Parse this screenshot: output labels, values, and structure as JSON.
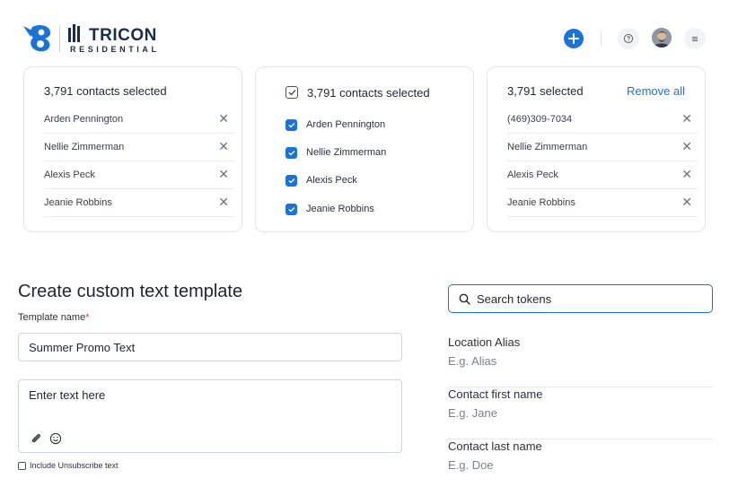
{
  "brand": {
    "name": "TRICON",
    "sub": "RESIDENTIAL",
    "accent": "#1a73d9",
    "navy": "#1c2b49"
  },
  "header": {
    "add_icon": "plus-icon",
    "help_icon": "question-icon",
    "menu_icon": "hamburger-icon"
  },
  "card1": {
    "title": "3,791 contacts selected",
    "items": [
      {
        "name": "Arden Pennington"
      },
      {
        "name": "Nellie Zimmerman"
      },
      {
        "name": "Alexis Peck"
      },
      {
        "name": "Jeanie Robbins"
      }
    ]
  },
  "card2": {
    "title": "3,791 contacts selected",
    "items": [
      {
        "name": "Arden Pennington",
        "checked": true
      },
      {
        "name": "Nellie Zimmerman",
        "checked": true
      },
      {
        "name": "Alexis Peck",
        "checked": true
      },
      {
        "name": "Jeanie Robbins",
        "checked": true
      }
    ]
  },
  "card3": {
    "title": "3,791 selected",
    "remove_all": "Remove all",
    "items": [
      {
        "name": "(469)309-7034"
      },
      {
        "name": "Nellie Zimmerman"
      },
      {
        "name": "Alexis Peck"
      },
      {
        "name": "Jeanie Robbins"
      }
    ]
  },
  "form": {
    "title": "Create custom text template",
    "name_label": "Template name",
    "required_mark": "*",
    "name_value": "Summer Promo Text",
    "message_placeholder": "Enter text here",
    "unsubscribe_label": "Include Unsubscribe text"
  },
  "tokens": {
    "search_placeholder": "Search tokens",
    "items": [
      {
        "name": "Location Alias",
        "example": "E.g. Alias"
      },
      {
        "name": "Contact first name",
        "example": "E.g. Jane"
      },
      {
        "name": "Contact last name",
        "example": "E.g. Doe"
      }
    ]
  }
}
